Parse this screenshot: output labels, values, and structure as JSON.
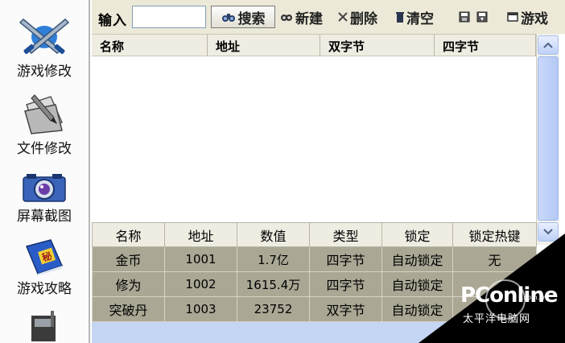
{
  "sidebar": {
    "items": [
      {
        "label": "游戏修改",
        "icon": "crossed-swords-icon"
      },
      {
        "label": "文件修改",
        "icon": "folder-pencil-icon"
      },
      {
        "label": "屏幕截图",
        "icon": "camera-icon"
      },
      {
        "label": "游戏攻略",
        "icon": "secret-book-icon",
        "badge": "秘"
      },
      {
        "label": "",
        "icon": "tools-icon"
      }
    ]
  },
  "toolbar": {
    "input_label": "输入",
    "input_value": "",
    "search_label": "搜索",
    "new_label": "新建",
    "delete_label": "删除",
    "clear_label": "清空",
    "game_label": "游戏"
  },
  "result_list": {
    "columns": [
      "名称",
      "地址",
      "双字节",
      "四字节"
    ],
    "rows": []
  },
  "locked_table": {
    "columns": [
      "名称",
      "地址",
      "数值",
      "类型",
      "锁定",
      "锁定热键"
    ],
    "rows": [
      [
        "金币",
        "1001",
        "1.7亿",
        "四字节",
        "自动锁定",
        "无"
      ],
      [
        "修为",
        "1002",
        "1615.4万",
        "四字节",
        "自动锁定",
        ""
      ],
      [
        "突破丹",
        "1003",
        "23752",
        "双字节",
        "自动锁定",
        ""
      ]
    ]
  },
  "watermark": {
    "brand": "PConline",
    "domain": ".com.cn",
    "cn": "太平洋电脑网"
  },
  "colors": {
    "toolbar_bg": "#ece9d8",
    "locked_row_bg": "#aaa795",
    "scrollbar": "#b4c9f5"
  }
}
